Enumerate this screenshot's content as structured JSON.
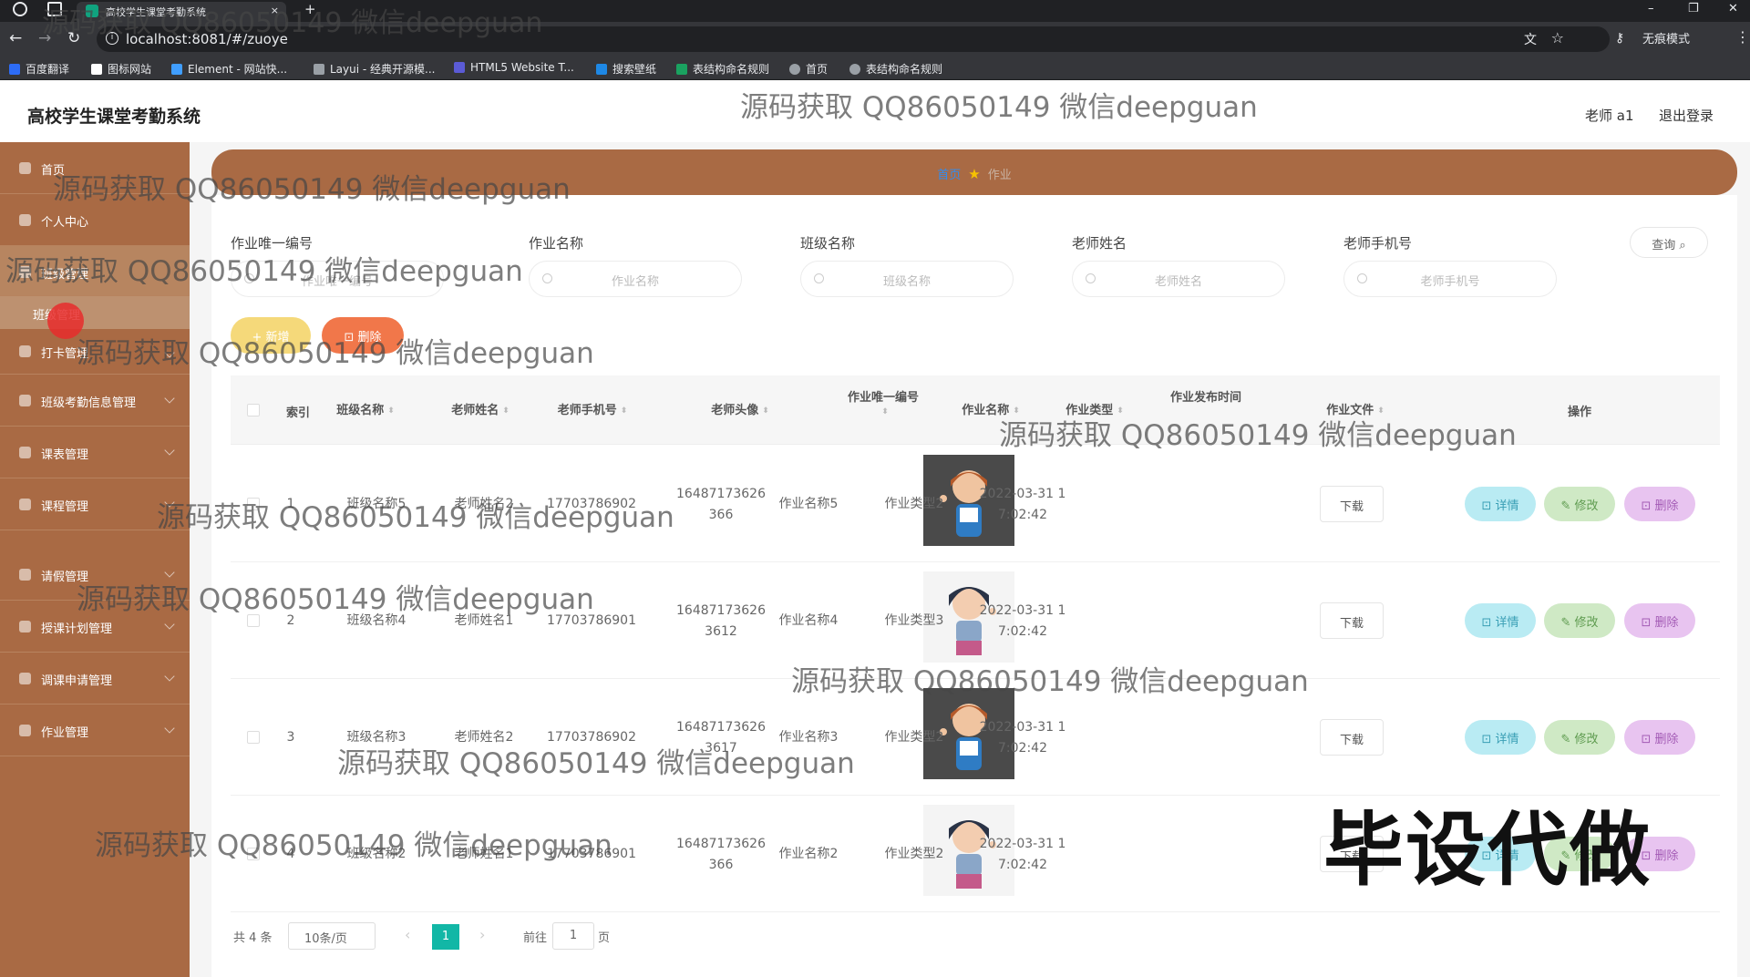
{
  "browser": {
    "tab_title": "高校学生课堂考勤系统",
    "tab_close": "×",
    "new_tab": "+",
    "win_min": "–",
    "win_max": "❐",
    "win_close": "✕",
    "back": "←",
    "forward": "→",
    "reload": "↻",
    "url": "localhost:8081/#/zuoye",
    "translate": "文",
    "star": "☆",
    "key": "⚷",
    "incognito": "无痕模式",
    "menu": "⋮",
    "bookmarks": [
      {
        "label": "百度翻译",
        "color": "#2d6cf6"
      },
      {
        "label": "图标网站",
        "color": "#ffffff"
      },
      {
        "label": "Element - 网站快...",
        "color": "#409eff"
      },
      {
        "label": "Layui - 经典开源模...",
        "color": "#e8eaed"
      },
      {
        "label": "HTML5 Website T...",
        "color": "#5b5bd6"
      },
      {
        "label": "搜索壁纸",
        "color": "#1e88e5"
      },
      {
        "label": "表结构命名规则",
        "color": "#1aa260"
      },
      {
        "label": "首页",
        "color": "#e8eaed"
      },
      {
        "label": "表结构命名规则",
        "color": "#e8eaed"
      }
    ]
  },
  "header": {
    "title": "高校学生课堂考勤系统",
    "user": "老师 a1",
    "logout": "退出登录"
  },
  "sidebar": {
    "items": [
      "首页",
      "个人中心",
      "班级管理",
      "打卡管理",
      "班级考勤信息管理",
      "课表管理",
      "课程管理",
      "请假管理",
      "授课计划管理",
      "调课申请管理",
      "作业管理"
    ],
    "sub_item": "班级管理"
  },
  "breadcrumb": {
    "home": "首页",
    "sep": "★",
    "current": "作业"
  },
  "filters": [
    {
      "label": "作业唯一编号",
      "placeholder": "作业唯一编号"
    },
    {
      "label": "作业名称",
      "placeholder": "作业名称"
    },
    {
      "label": "班级名称",
      "placeholder": "班级名称"
    },
    {
      "label": "老师姓名",
      "placeholder": "老师姓名"
    },
    {
      "label": "老师手机号",
      "placeholder": "老师手机号"
    }
  ],
  "search_button": "查询 ⌕",
  "actions": {
    "add": "+ 新增",
    "delete": "⊡ 删除"
  },
  "table": {
    "headers": [
      "索引",
      "班级名称",
      "老师姓名",
      "老师手机号",
      "老师头像",
      "作业唯一编号",
      "作业名称",
      "作业类型",
      "作业发布时间",
      "作业文件",
      "操作"
    ],
    "rows": [
      {
        "index": "1",
        "class": "班级名称5",
        "teacher": "老师姓名2",
        "phone": "17703786902",
        "avatar": "female-red",
        "id1": "16487173626",
        "id2": "366",
        "name": "作业名称5",
        "type": "作业类型2",
        "date": "2022-03-31 1",
        "time": "7:02:42"
      },
      {
        "index": "2",
        "class": "班级名称4",
        "teacher": "老师姓名1",
        "phone": "17703786901",
        "avatar": "female-dark",
        "id1": "16487173626",
        "id2": "3612",
        "name": "作业名称4",
        "type": "作业类型3",
        "date": "2022-03-31 1",
        "time": "7:02:42"
      },
      {
        "index": "3",
        "class": "班级名称3",
        "teacher": "老师姓名2",
        "phone": "17703786902",
        "avatar": "female-red",
        "id1": "16487173626",
        "id2": "3617",
        "name": "作业名称3",
        "type": "作业类型2",
        "date": "2022-03-31 1",
        "time": "7:02:42"
      },
      {
        "index": "4",
        "class": "班级名称2",
        "teacher": "老师姓名1",
        "phone": "17703786901",
        "avatar": "female-dark",
        "id1": "16487173626",
        "id2": "366",
        "name": "作业名称2",
        "type": "作业类型2",
        "date": "2022-03-31 1",
        "time": "7:02:42"
      }
    ],
    "download": "下载",
    "detail": "⊡ 详情",
    "edit": "✎ 修改",
    "remove": "⊡ 删除"
  },
  "pagination": {
    "total": "共 4 条",
    "size": "10条/页",
    "prev": "‹",
    "page": "1",
    "next": "›",
    "goto": "前往",
    "goto_value": "1",
    "page_unit": "页"
  },
  "watermark": "源码获取 QQ86050149 微信deepguan",
  "watermark_big": "毕设代做"
}
